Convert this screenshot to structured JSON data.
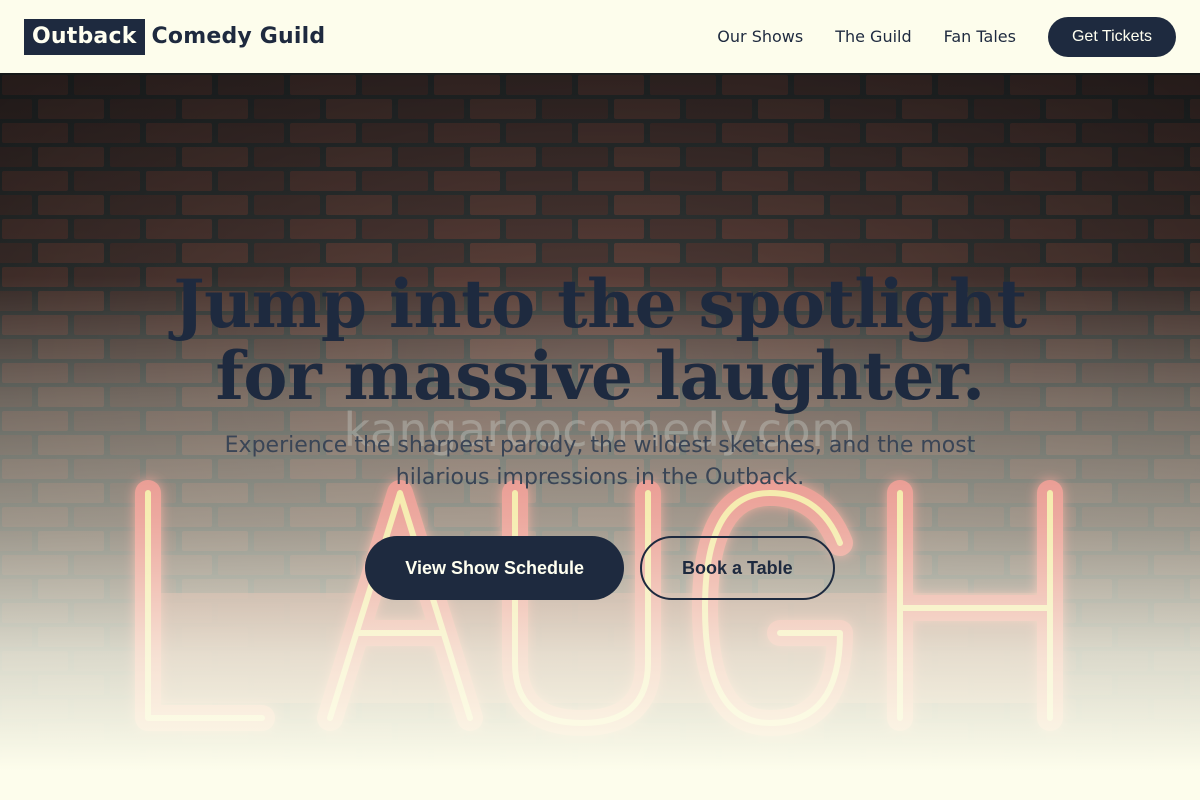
{
  "header": {
    "logo_highlight": "Outback",
    "logo_rest": "Comedy Guild",
    "nav": [
      {
        "label": "Our Shows"
      },
      {
        "label": "The Guild"
      },
      {
        "label": "Fan Tales"
      }
    ],
    "cta_label": "Get Tickets"
  },
  "hero": {
    "background_image": {
      "sign_text": "LAUGH",
      "watermark": "kangaroocomedy.com"
    },
    "headline_line1": "Jump into the spotlight",
    "headline_line2": "for massive laughter.",
    "subheadline": "Experience the sharpest parody, the wildest sketches, and the most hilarious impressions in the Outback.",
    "primary_button": "View Show Schedule",
    "secondary_button": "Book a Table"
  },
  "colors": {
    "navy": "#1e2a3f",
    "cream": "#fdfdec",
    "neon_red": "#e2504f",
    "neon_yellow": "#f6e27a"
  }
}
